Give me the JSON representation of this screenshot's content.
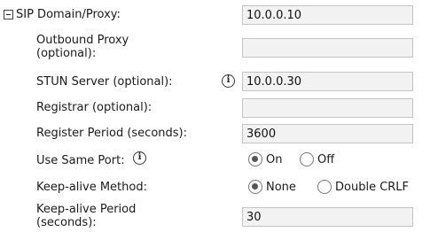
{
  "sip_domain": {
    "label": "SIP Domain/Proxy:",
    "value": "10.0.0.10"
  },
  "outbound_proxy": {
    "label_line1": "Outbound Proxy",
    "label_line2": "(optional):",
    "value": ""
  },
  "stun_server": {
    "label": "STUN Server (optional):",
    "value": "10.0.0.30"
  },
  "registrar": {
    "label": "Registrar (optional):",
    "value": ""
  },
  "register_period": {
    "label": "Register Period (seconds):",
    "value": "3600"
  },
  "use_same_port": {
    "label": "Use Same Port:",
    "options": [
      {
        "label": "On",
        "selected": true
      },
      {
        "label": "Off",
        "selected": false
      }
    ]
  },
  "keep_alive_method": {
    "label": "Keep-alive Method:",
    "options": [
      {
        "label": "None",
        "selected": true
      },
      {
        "label": "Double CRLF",
        "selected": false
      }
    ]
  },
  "keep_alive_period": {
    "label_line1": "Keep-alive Period",
    "label_line2": "(seconds):",
    "value": "30"
  },
  "icons": {
    "collapse": "collapse-minus-icon",
    "info": "info-icon"
  }
}
